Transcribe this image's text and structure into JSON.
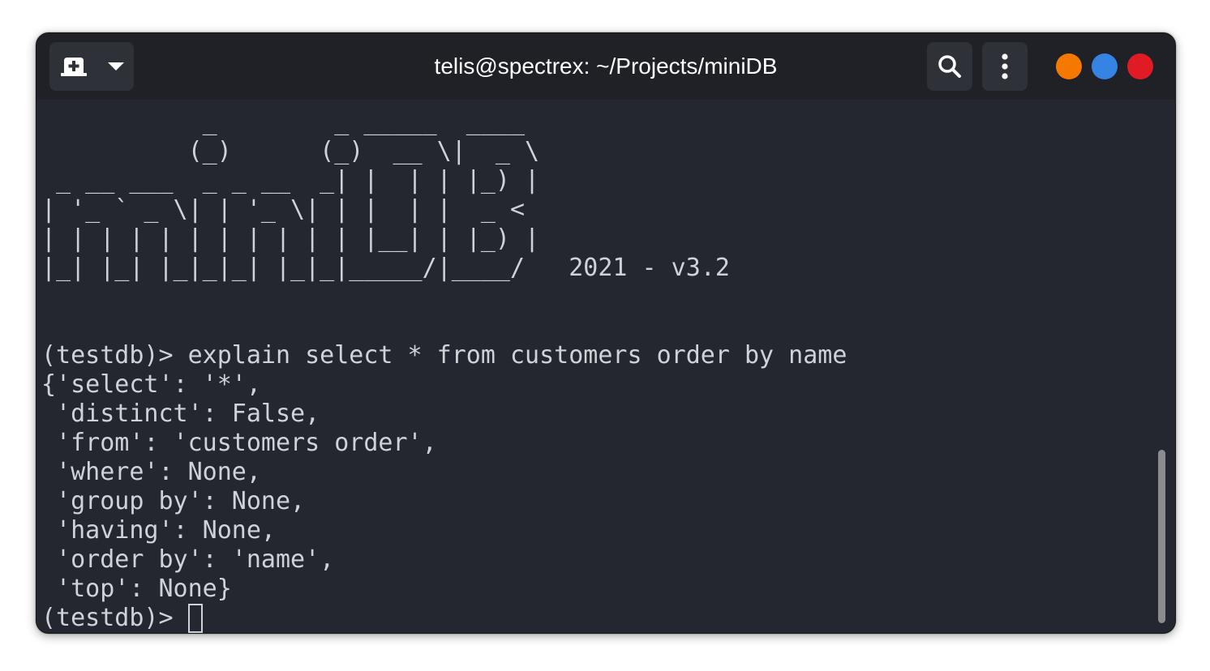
{
  "window": {
    "title": "telis@spectrex: ~/Projects/miniDB",
    "controls": {
      "minimize_color": "#f57900",
      "maximize_color": "#3584e4",
      "close_color": "#e01b24"
    }
  },
  "toolbar": {
    "new_tab_icon": "new-tab-icon",
    "dropdown_icon": "chevron-down-icon",
    "search_icon": "search-icon",
    "menu_icon": "kebab-menu-icon"
  },
  "terminal": {
    "banner": [
      "           _        _ _____  ____  ",
      "          (_)      (_)  __ \\|  _ \\ ",
      " _ __ ___  _ _ __  _| |  | | |_) |",
      "| '_ ` _ \\| | '_ \\| | |  | |  _ < ",
      "| | | | | | | | | | | |__| | |_) |",
      "|_| |_| |_|_|_| |_|_|_____/|____/   2021 - v3.2"
    ],
    "lines": [
      "(testdb)> explain select * from customers order by name",
      "{'select': '*',",
      " 'distinct': False,",
      " 'from': 'customers order',",
      " 'where': None,",
      " 'group by': None,",
      " 'having': None,",
      " 'order by': 'name',",
      " 'top': None}"
    ],
    "prompt": "(testdb)> "
  },
  "colors": {
    "background": "#242730",
    "text": "#cfd2d6",
    "titlebar": "#1f2127"
  }
}
